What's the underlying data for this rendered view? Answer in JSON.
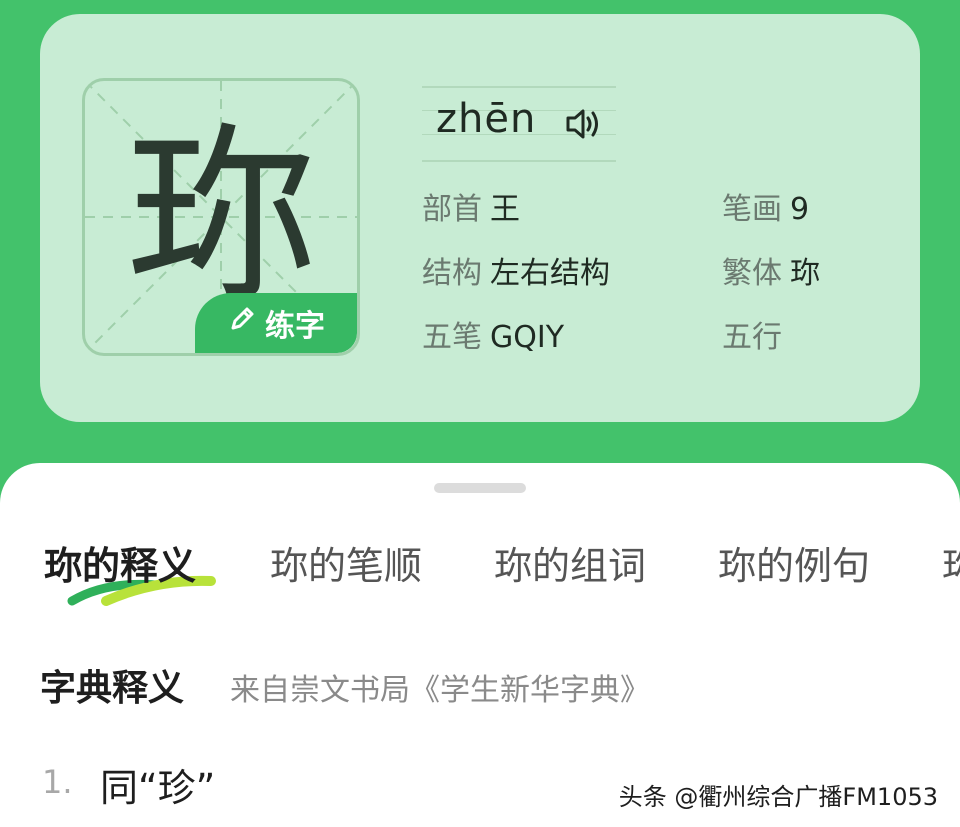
{
  "character": "珎",
  "practice_label": "练字",
  "pinyin": "zhēn",
  "info": {
    "radical_label": "部首",
    "radical_value": "王",
    "strokes_label": "笔画",
    "strokes_value": "9",
    "structure_label": "结构",
    "structure_value": "左右结构",
    "traditional_label": "繁体",
    "traditional_value": "珎",
    "wubi_label": "五笔",
    "wubi_value": "GQIY",
    "wuxing_label": "五行",
    "wuxing_value": ""
  },
  "tabs": [
    {
      "label": "珎的释义"
    },
    {
      "label": "珎的笔顺"
    },
    {
      "label": "珎的组词"
    },
    {
      "label": "珎的例句"
    },
    {
      "label": "珎"
    }
  ],
  "section": {
    "title": "字典释义",
    "source": "来自崇文书局《学生新华字典》"
  },
  "definitions": [
    {
      "num": "1.",
      "text": "同“珍”"
    }
  ],
  "watermark": "头条 @衢州综合广播FM1053",
  "colors": {
    "brand_green": "#43c26b",
    "card_bg": "#c8ecd4",
    "button_green": "#37b863"
  }
}
